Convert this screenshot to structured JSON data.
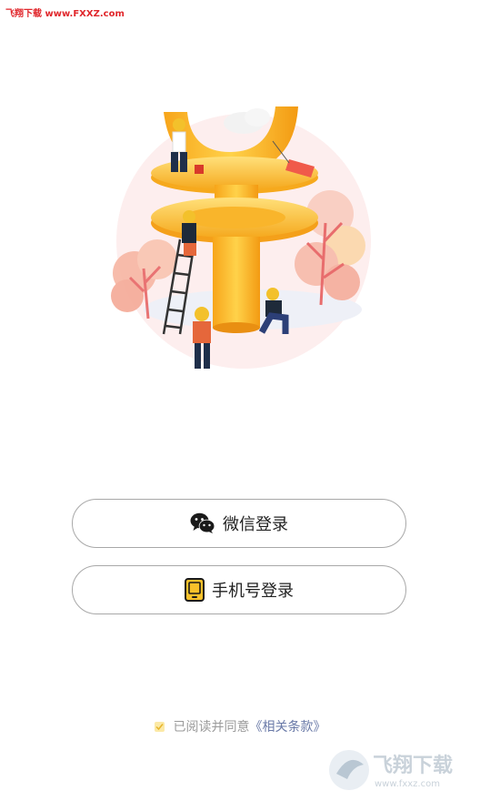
{
  "watermark_top": "飞翔下载 www.FXXZ.com",
  "buttons": {
    "wechat_label": "微信登录",
    "phone_label": "手机号登录"
  },
  "agreement": {
    "text": "已阅读并同意",
    "terms_link": "《相关条款》",
    "checked": true
  },
  "watermark_logo": {
    "brand": "飞翔下载",
    "url": "www.fxxz.com"
  },
  "colors": {
    "accent_yellow": "#f8c12a",
    "text_dark": "#222222",
    "text_gray": "#9a9a9a",
    "link": "#6a7aa8",
    "border": "#a8a8a8"
  }
}
